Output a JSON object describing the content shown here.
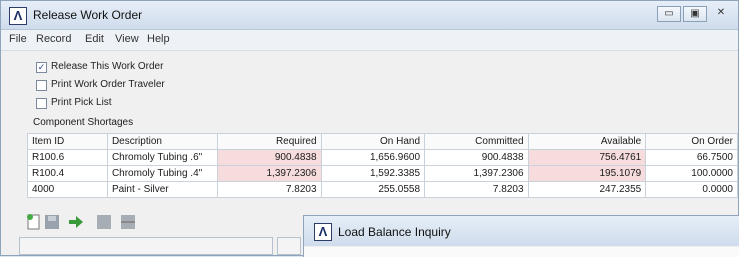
{
  "window": {
    "title": "Release Work Order",
    "logo": "Λ"
  },
  "menubar": [
    "File",
    "Record",
    "Edit",
    "View",
    "Help"
  ],
  "options": [
    {
      "label": "Release This Work Order",
      "checked": true
    },
    {
      "label": "Print Work Order Traveler",
      "checked": false
    },
    {
      "label": "Print Pick List",
      "checked": false
    }
  ],
  "section_label": "Component Shortages",
  "table": {
    "headers": [
      "Item ID",
      "Description",
      "Required",
      "On Hand",
      "Committed",
      "Available",
      "On Order"
    ],
    "rows": [
      [
        "R100.6",
        "Chromoly Tubing .6\"",
        "900.4838",
        "1,656.9600",
        "900.4838",
        "756.4761",
        "66.7500"
      ],
      [
        "R100.4",
        "Chromoly Tubing .4\"",
        "1,397.2306",
        "1,592.3385",
        "1,397.2306",
        "195.1079",
        "100.0000"
      ],
      [
        "4000",
        "Paint - Silver",
        "7.8203",
        "255.0558",
        "7.8203",
        "247.2355",
        "0.0000"
      ]
    ]
  },
  "icons": [
    "new-icon",
    "save-icon",
    "go-icon",
    "print-icon",
    "delete-icon"
  ],
  "colors": {
    "shortage_highlight": "#f6dcdc",
    "titlebar": "#d8e4f1"
  },
  "secondary_window": {
    "title": "Load Balance Inquiry",
    "logo": "Λ"
  }
}
